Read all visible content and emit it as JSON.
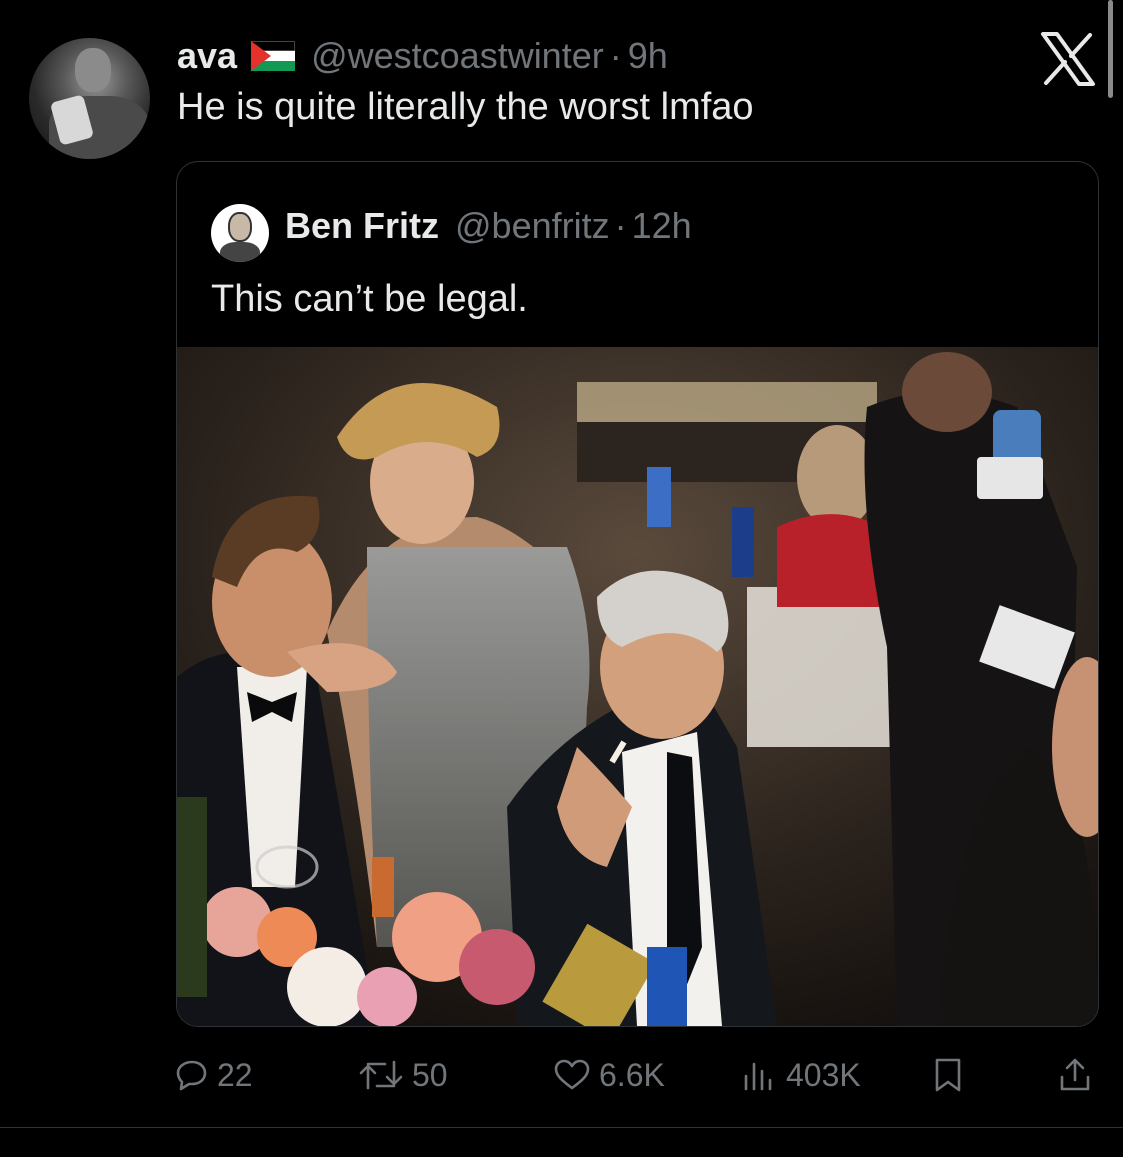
{
  "tweet": {
    "display_name": "ava",
    "flag_icon": "palestine-flag-icon",
    "handle": "@westcoastwinter",
    "separator": "·",
    "time": "9h",
    "text": "He is quite literally the worst lmfao"
  },
  "quoted_tweet": {
    "display_name": "Ben Fritz",
    "handle": "@benfritz",
    "separator": "·",
    "time": "12h",
    "text": "This can’t be legal."
  },
  "actions": {
    "replies": "22",
    "retweets": "50",
    "likes": "6.6K",
    "views": "403K"
  },
  "icons": {
    "close": "x-logo-icon",
    "reply": "reply-icon",
    "retweet": "retweet-icon",
    "like": "heart-icon",
    "views": "views-icon",
    "bookmark": "bookmark-icon",
    "share": "share-icon"
  },
  "colors": {
    "background": "#000000",
    "text": "#e7e9ea",
    "secondary": "#71767b",
    "border": "#2f3336"
  }
}
